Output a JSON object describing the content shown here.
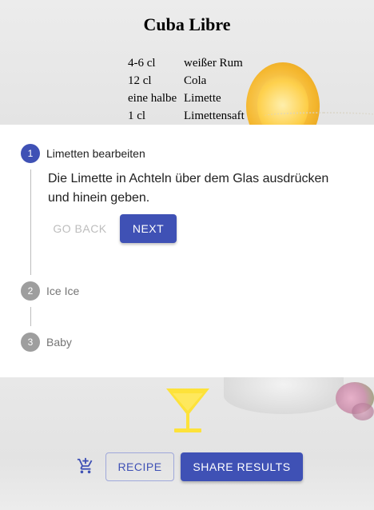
{
  "recipe": {
    "title": "Cuba Libre",
    "ingredients": [
      {
        "amount": "4-6 cl",
        "name": "weißer Rum"
      },
      {
        "amount": "12 cl",
        "name": "Cola"
      },
      {
        "amount": "eine halbe",
        "name": "Limette"
      },
      {
        "amount": "1 cl",
        "name": "Limettensaft"
      }
    ]
  },
  "stepper": {
    "steps": [
      {
        "number": "1",
        "label": "Limetten bearbeiten",
        "state": "active"
      },
      {
        "number": "2",
        "label": "Ice Ice",
        "state": "inactive"
      },
      {
        "number": "3",
        "label": "Baby",
        "state": "inactive"
      }
    ],
    "active_text": "Die Limette in Achteln über dem Glas ausdrücken und hinein geben.",
    "back_label": "GO BACK",
    "next_label": "NEXT"
  },
  "actions": {
    "cart_icon": "add-shopping-cart-icon",
    "cocktail_icon": "cocktail-glass-icon",
    "recipe_label": "RECIPE",
    "share_label": "SHARE RESULTS"
  },
  "colors": {
    "primary": "#3f51b5",
    "inactive_step": "#9e9e9e",
    "cocktail_icon": "#fde23a"
  }
}
